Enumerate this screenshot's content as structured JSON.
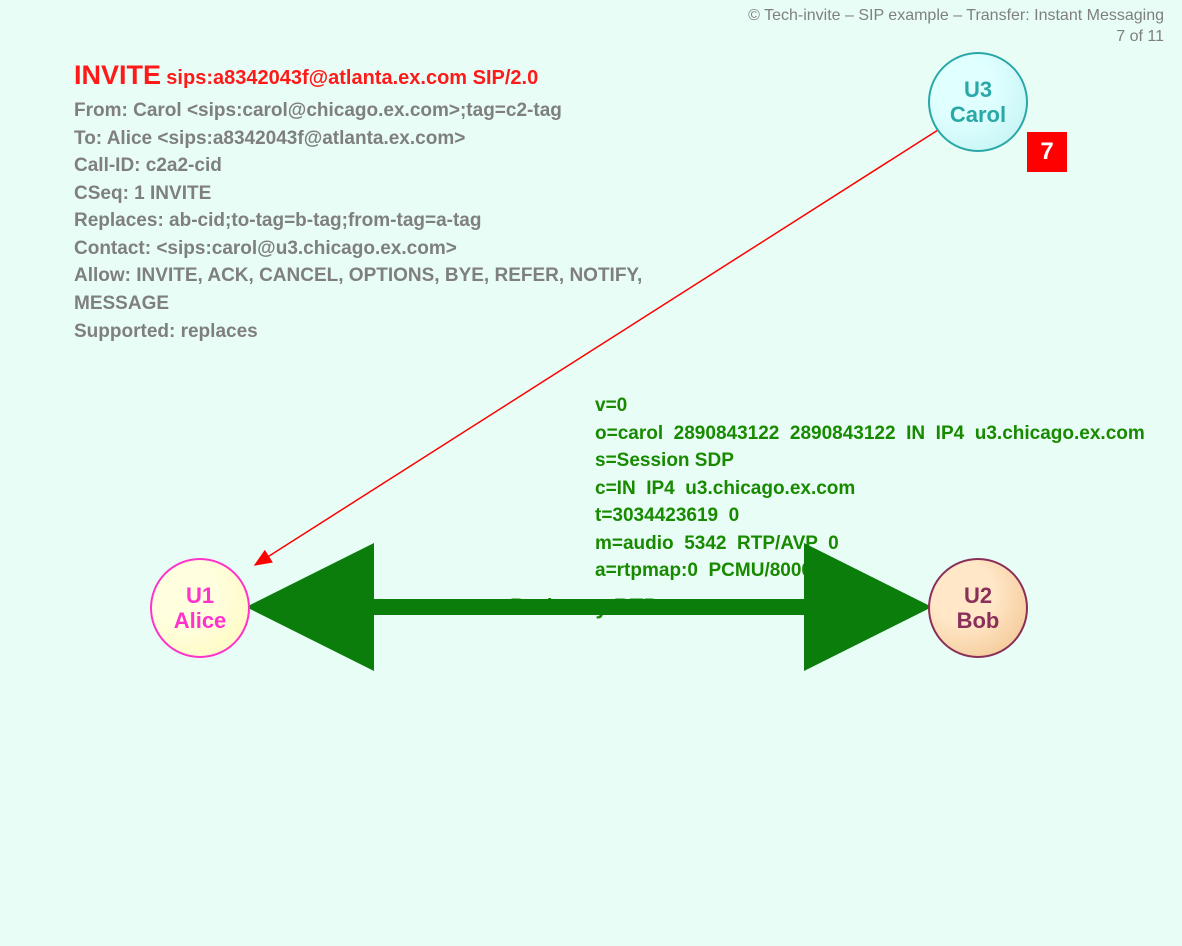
{
  "meta": {
    "attribution": "© Tech-invite – SIP example – Transfer: Instant Messaging",
    "page_label": "7 of 11"
  },
  "step_badge": "7",
  "request": {
    "method": "INVITE",
    "uri_line": "sips:a8342043f@atlanta.ex.com SIP/2.0",
    "headers": [
      "From: Carol <sips:carol@chicago.ex.com>;tag=c2-tag",
      "To: Alice <sips:a8342043f@atlanta.ex.com>",
      "Call-ID: c2a2-cid",
      "CSeq: 1 INVITE",
      "Replaces: ab-cid;to-tag=b-tag;from-tag=a-tag",
      "Contact: <sips:carol@u3.chicago.ex.com>",
      "Allow: INVITE, ACK, CANCEL, OPTIONS, BYE, REFER, NOTIFY,",
      " MESSAGE",
      "Supported: replaces"
    ]
  },
  "sdp_lines": [
    "v=0",
    "o=carol  2890843122  2890843122  IN  IP4  u3.chicago.ex.com",
    "s=Session SDP",
    "c=IN  IP4  u3.chicago.ex.com",
    "t=3034423619  0",
    "m=audio  5342  RTP/AVP  0",
    "a=rtpmap:0  PCMU/8000"
  ],
  "rtp_label": "Both way RTP",
  "nodes": {
    "u1": {
      "id": "U1",
      "name": "Alice"
    },
    "u2": {
      "id": "U2",
      "name": "Bob"
    },
    "u3": {
      "id": "U3",
      "name": "Carol"
    }
  }
}
